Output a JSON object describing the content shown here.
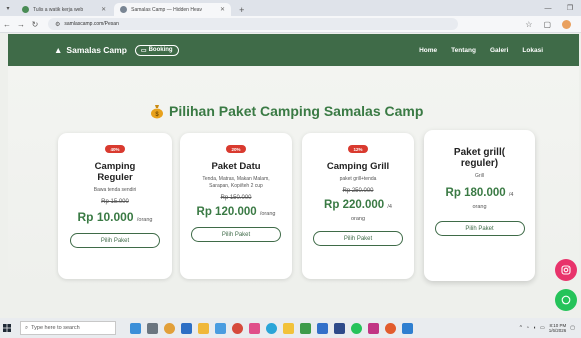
{
  "browser": {
    "tabs": [
      {
        "title": "Tulis a watik kerja web",
        "active": false
      },
      {
        "title": "Samalas Camp — Hidden Heav",
        "active": true
      }
    ],
    "new_tab": "+",
    "url": "samlascamp.com/Pesan"
  },
  "site": {
    "brand": "Samalas Camp",
    "booking_label": "Booking",
    "nav": [
      "Home",
      "Tentang",
      "Galeri",
      "Lokasi"
    ]
  },
  "heading": "Pilihan Paket Camping Samalas Camp",
  "packages": [
    {
      "badge": "40%",
      "title": "Camping Reguler",
      "desc": "Bawa tenda sendiri",
      "old_price": "Rp 15.000",
      "price": "Rp 10.000",
      "unit": "/orang",
      "button": "Pilih Paket"
    },
    {
      "badge": "20%",
      "title": "Paket Datu",
      "desc": "Tenda, Matras, Makan Malam, Sarapan, Kopi/teh 2 cup",
      "old_price": "Rp 150.000",
      "price": "Rp 120.000",
      "unit": "/orang",
      "button": "Pilih Paket"
    },
    {
      "badge": "12%",
      "title": "Camping Grill",
      "desc": "paket grill+tenda",
      "old_price": "Rp 250.000",
      "price": "Rp 220.000",
      "unit": "/4",
      "unit2": "orang",
      "button": "Pilih Paket"
    },
    {
      "title": "Paket grill( reguler)",
      "desc": "Grill",
      "price": "Rp 180.000",
      "unit": "/4",
      "unit2": "orang",
      "button": "Pilih Paket"
    }
  ],
  "taskbar": {
    "search_placeholder": "Type here to search",
    "time": "8:10 PM",
    "date": "1/6/2026"
  },
  "colors": {
    "brand_green": "#3f6b48",
    "price_green": "#3a7a44",
    "badge_red": "#d93a2f",
    "instagram": "#e8336b",
    "whatsapp": "#25c35a"
  }
}
